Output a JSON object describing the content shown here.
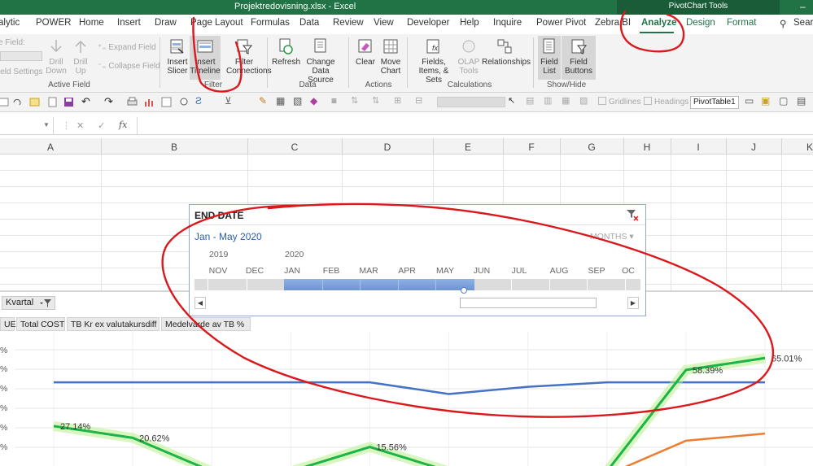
{
  "window": {
    "title": "Projektredovisning.xlsx  -  Excel",
    "context_tools": "PivotChart Tools",
    "search_label": "Search"
  },
  "tabs": [
    "alytic",
    "POWER",
    "Home",
    "Insert",
    "Draw",
    "Page Layout",
    "Formulas",
    "Data",
    "Review",
    "View",
    "Developer",
    "Help",
    "Inquire",
    "Power Pivot",
    "Zebra BI",
    "Analyze",
    "Design",
    "Format"
  ],
  "active_tab": "Analyze",
  "ribbon": {
    "active_field": {
      "field_label": "e Field:",
      "field_settings": "ield Settings",
      "drill_down": "Drill Down",
      "drill_up": "Drill Up",
      "expand_field": "Expand Field",
      "collapse_field": "Collapse Field",
      "group_label": "Active Field"
    },
    "filter": {
      "insert_slicer": "Insert Slicer",
      "insert_timeline": "Insert Timeline",
      "filter_connections": "Filter Connections",
      "group_label": "Filter"
    },
    "data": {
      "refresh": "Refresh",
      "change_data_source": "Change Data Source",
      "group_label": "Data"
    },
    "actions": {
      "clear": "Clear",
      "move_chart": "Move Chart",
      "group_label": "Actions"
    },
    "calculations": {
      "fields_items_sets": "Fields, Items, & Sets",
      "olap_tools": "OLAP Tools",
      "relationships": "Relationships",
      "group_label": "Calculations"
    },
    "show_hide": {
      "field_list": "Field List",
      "field_buttons": "Field Buttons",
      "group_label": "Show/Hide"
    }
  },
  "qat": {
    "gridlines": "Gridlines",
    "headings": "Headings",
    "pivot_name": "PivotTable1"
  },
  "formula_bar": {
    "fx": "fx",
    "cancel": "✕",
    "enter": "✓"
  },
  "columns": [
    "A",
    "B",
    "C",
    "D",
    "E",
    "F",
    "G",
    "H",
    "I",
    "J",
    "K"
  ],
  "timeline": {
    "title": "END DATE",
    "range": "Jan - May 2020",
    "level": "MONTHS",
    "years": [
      "2019",
      "2020"
    ],
    "months": [
      "NOV",
      "DEC",
      "JAN",
      "FEB",
      "MAR",
      "APR",
      "MAY",
      "JUN",
      "JUL",
      "AUG",
      "SEP",
      "OC"
    ],
    "selected_start": "JAN",
    "selected_end": "MAY"
  },
  "pivot_chart": {
    "filter_button": "Kvartal",
    "legend_buttons": [
      "UE",
      "Total COST",
      "TB Kr ex valutakursdiff",
      "Medelvärde av TB %"
    ],
    "y_axis_ticks": [
      "%",
      "%",
      "%",
      "%",
      "%",
      "%"
    ]
  },
  "chart_data": {
    "type": "line",
    "x": [
      1,
      2,
      3,
      4,
      5,
      6,
      7,
      8,
      9,
      10
    ],
    "series": [
      {
        "values": [
          51.5,
          51.5,
          51.5,
          51.5,
          51.5,
          45,
          49,
          51.5,
          51.5,
          51.5
        ],
        "color": "#4472c4"
      },
      {
        "values": [
          27.14,
          20.62,
          2,
          2,
          15.56,
          2,
          2,
          2,
          58.39,
          65.01
        ],
        "color": "#1db34b",
        "labels": [
          "27.14%",
          "20.62%",
          "",
          "",
          "15.56%",
          "",
          "",
          "",
          "58.39%",
          "65.01%"
        ]
      },
      {
        "values": [
          4,
          2,
          0,
          0,
          0,
          0,
          0,
          0,
          19,
          23
        ],
        "color": "#ed7d31"
      }
    ]
  },
  "colors": {
    "excel_green": "#217346",
    "annotation": "#d9191c",
    "timeline_selection": "#7fa3dc"
  }
}
